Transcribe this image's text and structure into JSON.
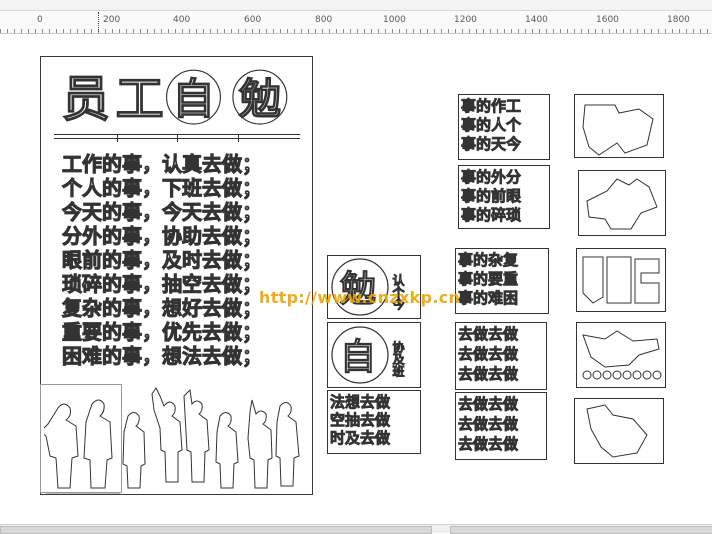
{
  "ruler": {
    "labels": [
      "0",
      "200",
      "400",
      "600",
      "800",
      "1000",
      "1200",
      "1400",
      "1600",
      "1800"
    ]
  },
  "poster": {
    "title_chars": [
      "员",
      "工",
      "自",
      "勉"
    ],
    "verses": [
      "工作的事，认真去做；",
      "个人的事，下班去做；",
      "今天的事，今天去做；",
      "分外的事，协助去做；",
      "眼前的事，及时去做；",
      "琐碎的事，抽空去做；",
      "复杂的事，想好去做；",
      "重要的事，优先去做；",
      "困难的事，想法去做；"
    ]
  },
  "tiles": {
    "t1": [
      "事的作工",
      "事的人个",
      "事的天今"
    ],
    "t2": [
      "事的外分",
      "事的前眼",
      "事的碎琐"
    ],
    "t3": [
      "事的杂复",
      "事的要重",
      "事的难困"
    ],
    "t4_char": "勉",
    "t4_side": "认个今",
    "t5_char": "自",
    "t5_side": "协及班",
    "t6": [
      "法想去做",
      "空抽去做",
      "时及去做"
    ],
    "t7": [
      "去做去做",
      "去做去做",
      "去做去做"
    ],
    "t8": [
      "去做去做",
      "去做去做",
      "去做去做"
    ],
    "t9": [
      "去做去做",
      "去做去做",
      "去做去做"
    ]
  },
  "watermark": "http://www.cnzxkp.cn",
  "colors": {
    "outline": "#333333",
    "watermark": "#f0a500"
  }
}
